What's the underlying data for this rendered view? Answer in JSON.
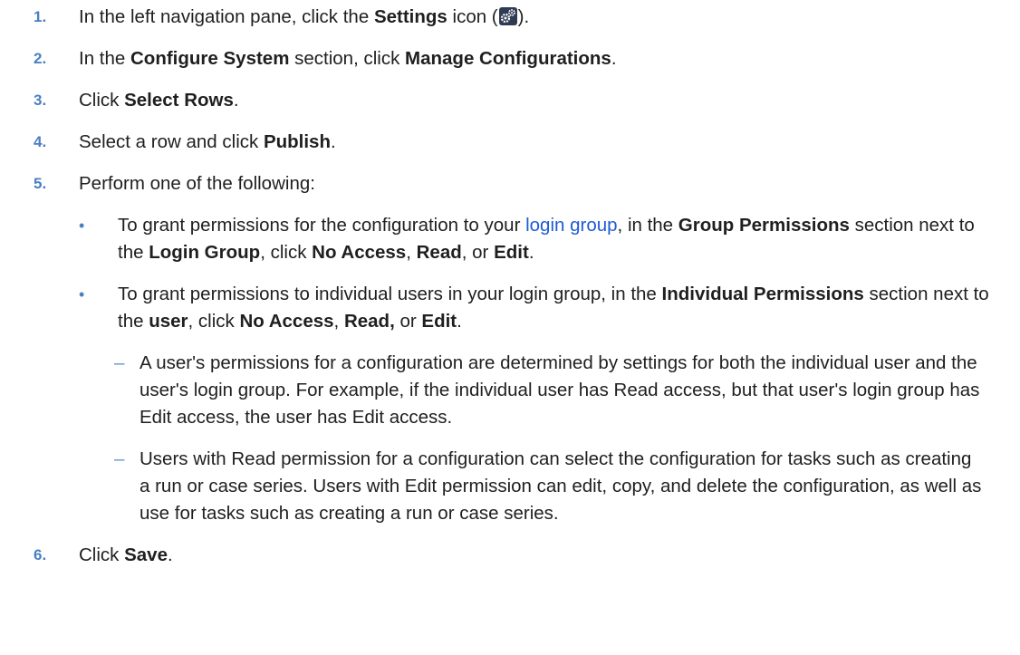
{
  "steps": [
    {
      "num": "1.",
      "pre": "In the left navigation pane, click the ",
      "b1": "Settings",
      "mid": " icon (",
      "post": ")."
    },
    {
      "num": "2.",
      "pre": "In the ",
      "b1": "Configure System",
      "mid": " section, click ",
      "b2": "Manage Configurations",
      "post": "."
    },
    {
      "num": "3.",
      "pre": "Click ",
      "b1": "Select Rows",
      "post": "."
    },
    {
      "num": "4.",
      "pre": "Select a row and click ",
      "b1": "Publish",
      "post": "."
    },
    {
      "num": "5.",
      "pre": "Perform one of the following:"
    },
    {
      "num": "6.",
      "pre": "Click ",
      "b1": "Save",
      "post": "."
    }
  ],
  "bullets": [
    {
      "t1": "To grant permissions for the configuration to your ",
      "link": "login group",
      "t2": ", in the ",
      "b1": "Group Permissions",
      "t3": " section next to the ",
      "b2": "Login Group",
      "t4": ", click ",
      "b3": "No Access",
      "t5": ", ",
      "b4": "Read",
      "t6": ", or ",
      "b5": "Edit",
      "t7": "."
    },
    {
      "t1": "To grant permissions to individual users in your login group, in the ",
      "b1": "Individual Permissions",
      "t2": " section next to the ",
      "b2": "user",
      "t3": ", click ",
      "b3": "No Access",
      "t4": ", ",
      "b4": "Read,",
      "t5": " or ",
      "b5": "Edit",
      "t6": "."
    }
  ],
  "notes": [
    "A user's permissions for a configuration are determined by settings for both the individual user and the user's login group. For example, if the individual user has Read access, but that user's login group has Edit access, the user has Edit access.",
    "Users with Read permission for a configuration can select the configuration for tasks such as creating a run or case series. Users with Edit permission can edit, copy, and delete the configuration, as well as use for tasks such as creating a run or case series."
  ],
  "icons": {
    "settings": "settings-gear-icon",
    "bullet": "•",
    "dash": "–"
  },
  "colors": {
    "step_number": "#4a7fc1",
    "link": "#1f5bd6"
  }
}
